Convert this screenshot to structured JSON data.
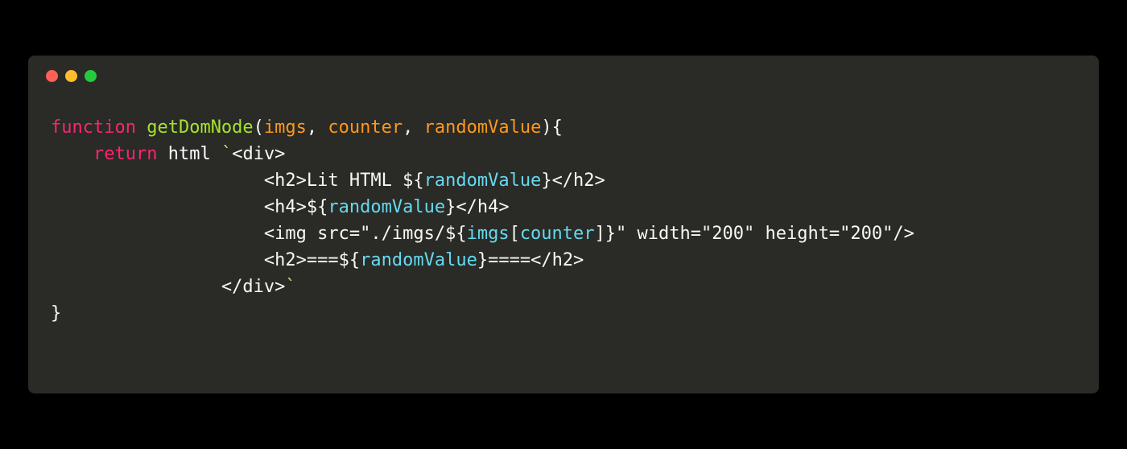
{
  "code": {
    "line1": {
      "function_kw": "function",
      "fn_name": "getDomNode",
      "param1": "imgs",
      "param2": "counter",
      "param3": "randomValue",
      "open_brace": "{",
      "comma": ", ",
      "paren_open": "(",
      "paren_close": ")"
    },
    "line2": {
      "indent": "    ",
      "return_kw": "return",
      "html_ident": " html ",
      "tick_open": "`",
      "div_open": "<div>"
    },
    "line3": {
      "indent": "                    ",
      "h2_open": "<h2>",
      "text": "Lit HTML ",
      "interp_open": "${",
      "var": "randomValue",
      "interp_close": "}",
      "h2_close": "</h2>"
    },
    "line4": {
      "indent": "                    ",
      "h4_open": "<h4>",
      "interp_open": "${",
      "var": "randomValue",
      "interp_close": "}",
      "h4_close": "</h4>"
    },
    "line5": {
      "indent": "                    ",
      "img_start": "<img src=\"./imgs/",
      "interp_open": "${",
      "var1": "imgs",
      "bracket_open": "[",
      "var2": "counter",
      "bracket_close": "]",
      "interp_close": "}",
      "img_end": "\" width=\"200\" height=\"200\"/>"
    },
    "line6": {
      "indent": "                    ",
      "h2_open": "<h2>",
      "eq1": "===",
      "interp_open": "${",
      "var": "randomValue",
      "interp_close": "}",
      "eq2": "====",
      "h2_close": "</h2>"
    },
    "line7": {
      "indent": "                ",
      "div_close": "</div>",
      "tick_close": "`"
    },
    "line8": {
      "close_brace": "}"
    }
  }
}
